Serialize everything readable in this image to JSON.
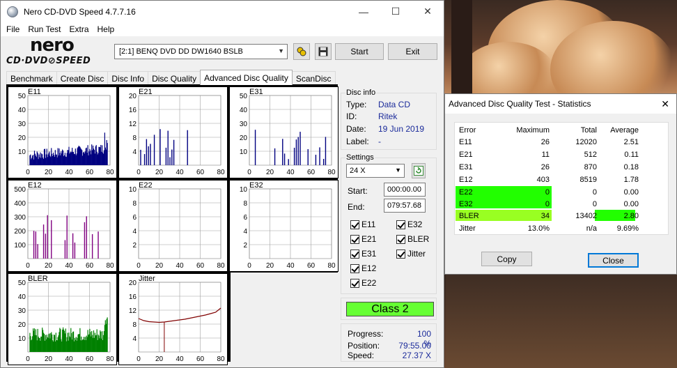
{
  "window": {
    "title": "Nero CD-DVD Speed 4.7.7.16",
    "controls": {
      "minimize": "—",
      "maximize": "☐",
      "close": "✕"
    }
  },
  "menu": [
    "File",
    "Run Test",
    "Extra",
    "Help"
  ],
  "logo": {
    "brand": "nero",
    "product": "CD·DVD⊘SPEED"
  },
  "toolbar": {
    "drive": "[2:1]   BENQ DVD DD DW1640 BSLB",
    "start_label": "Start",
    "exit_label": "Exit"
  },
  "tabs": [
    "Benchmark",
    "Create Disc",
    "Disc Info",
    "Disc Quality",
    "Advanced Disc Quality",
    "ScanDisc"
  ],
  "active_tab": "Advanced Disc Quality",
  "disc_info": {
    "group_label": "Disc info",
    "type_label": "Type:",
    "type": "Data CD",
    "id_label": "ID:",
    "id": "Ritek",
    "date_label": "Date:",
    "date": "19 Jun 2019",
    "label_label": "Label:",
    "label": "-"
  },
  "settings": {
    "group_label": "Settings",
    "speed": "24 X",
    "start_label": "Start:",
    "start": "000:00.00",
    "end_label": "End:",
    "end": "079:57.68",
    "checks": [
      "E11",
      "E32",
      "E21",
      "BLER",
      "E31",
      "Jitter",
      "E12",
      "E22"
    ]
  },
  "class_label": "Class 2",
  "progress": {
    "progress_label": "Progress:",
    "progress": "100 %",
    "position_label": "Position:",
    "position": "79:55.00",
    "speed_label": "Speed:",
    "speed": "27.37 X"
  },
  "colors": {
    "class_badge": "#66ff33",
    "bler_series": "#008000",
    "error_series": "#000080",
    "e12_series": "#800080",
    "jitter_series": "#800000"
  },
  "chart_data": [
    {
      "type": "area",
      "title": "E11",
      "xlim": [
        0,
        80
      ],
      "ylim": [
        0,
        50
      ],
      "yticks": [
        10,
        20,
        30,
        40,
        50
      ],
      "xticks": [
        0,
        20,
        40,
        60,
        80
      ],
      "max": 26
    },
    {
      "type": "bar",
      "title": "E21",
      "xlim": [
        0,
        80
      ],
      "ylim": [
        0,
        20
      ],
      "yticks": [
        4,
        8,
        12,
        16,
        20
      ],
      "xticks": [
        0,
        20,
        40,
        60,
        80
      ],
      "max": 11
    },
    {
      "type": "bar",
      "title": "E31",
      "xlim": [
        0,
        80
      ],
      "ylim": [
        0,
        50
      ],
      "yticks": [
        10,
        20,
        30,
        40,
        50
      ],
      "xticks": [
        0,
        20,
        40,
        60,
        80
      ],
      "max": 26
    },
    {
      "type": "bar",
      "title": "E12",
      "xlim": [
        0,
        80
      ],
      "ylim": [
        0,
        500
      ],
      "yticks": [
        100,
        200,
        300,
        400,
        500
      ],
      "xticks": [
        0,
        20,
        40,
        60,
        80
      ],
      "max": 403
    },
    {
      "type": "bar",
      "title": "E22",
      "xlim": [
        0,
        80
      ],
      "ylim": [
        0,
        10
      ],
      "yticks": [
        2,
        4,
        6,
        8,
        10
      ],
      "xticks": [
        0,
        20,
        40,
        60,
        80
      ],
      "max": 0
    },
    {
      "type": "bar",
      "title": "E32",
      "xlim": [
        0,
        80
      ],
      "ylim": [
        0,
        10
      ],
      "yticks": [
        2,
        4,
        6,
        8,
        10
      ],
      "xticks": [
        0,
        20,
        40,
        60,
        80
      ],
      "max": 0
    },
    {
      "type": "area",
      "title": "BLER",
      "xlim": [
        0,
        80
      ],
      "ylim": [
        0,
        50
      ],
      "yticks": [
        10,
        20,
        30,
        40,
        50
      ],
      "xticks": [
        0,
        20,
        40,
        60,
        80
      ],
      "max": 34
    },
    {
      "type": "line",
      "title": "Jitter",
      "xlim": [
        0,
        80
      ],
      "ylim": [
        0,
        20
      ],
      "yticks": [
        4,
        8,
        12,
        16,
        20
      ],
      "xticks": [
        0,
        20,
        40,
        60,
        80
      ],
      "x": [
        0,
        5,
        10,
        15,
        20,
        25,
        30,
        35,
        40,
        45,
        50,
        55,
        60,
        65,
        70,
        75,
        80
      ],
      "y": [
        9.6,
        9.0,
        8.7,
        8.6,
        8.5,
        8.6,
        8.8,
        9.0,
        9.2,
        9.4,
        9.7,
        10.0,
        10.3,
        10.6,
        11.0,
        11.4,
        12.6
      ]
    }
  ],
  "stats": {
    "title": "Advanced Disc Quality Test - Statistics",
    "headers": [
      "Error",
      "Maximum",
      "Total",
      "Average"
    ],
    "rows": [
      [
        "E11",
        "26",
        "12020",
        "2.51"
      ],
      [
        "E21",
        "11",
        "512",
        "0.11"
      ],
      [
        "E31",
        "26",
        "870",
        "0.18"
      ],
      [
        "E12",
        "403",
        "8519",
        "1.78"
      ],
      [
        "E22",
        "0",
        "0",
        "0.00"
      ],
      [
        "E32",
        "0",
        "0",
        "0.00"
      ],
      [
        "BLER",
        "34",
        "13402",
        "2.80"
      ],
      [
        "Jitter",
        "13.0%",
        "n/a",
        "9.69%"
      ]
    ],
    "copy_label": "Copy",
    "close_label": "Close"
  }
}
